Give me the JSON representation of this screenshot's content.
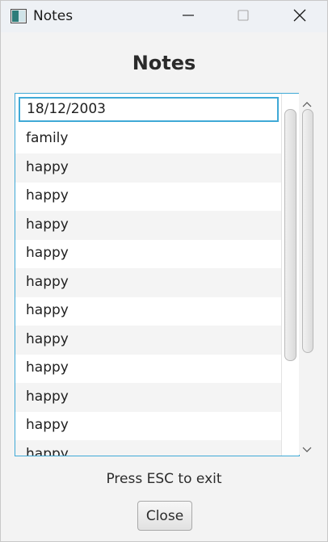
{
  "window": {
    "title": "Notes",
    "icon": "app-window-icon",
    "controls": {
      "minimize_icon": "minimize-icon",
      "maximize_icon": "maximize-icon",
      "close_icon": "close-icon"
    }
  },
  "heading": "Notes",
  "list": {
    "editing_value": "18/12/2003",
    "items": [
      "family",
      "happy",
      "happy",
      "happy",
      "happy",
      "happy",
      "happy",
      "happy",
      "happy",
      "happy",
      "happy",
      "happy"
    ]
  },
  "footer": {
    "hint": "Press ESC to exit",
    "close_label": "Close"
  },
  "colors": {
    "accent": "#3fa9d6",
    "background": "#f3f3f3"
  }
}
